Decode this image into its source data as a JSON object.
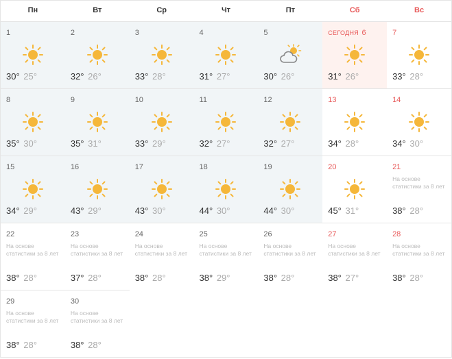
{
  "headers": [
    {
      "label": "Пн",
      "weekend": false
    },
    {
      "label": "Вт",
      "weekend": false
    },
    {
      "label": "Ср",
      "weekend": false
    },
    {
      "label": "Чт",
      "weekend": false
    },
    {
      "label": "Пт",
      "weekend": false
    },
    {
      "label": "Сб",
      "weekend": true
    },
    {
      "label": "Вс",
      "weekend": true
    }
  ],
  "today_label": "СЕГОДНЯ",
  "stat_note": "На основе статистики за 8 лет",
  "days": [
    {
      "num": "1",
      "icon": "sun",
      "high": "30°",
      "low": "25°",
      "weekend": false,
      "today": false,
      "stat": false,
      "shaded": true
    },
    {
      "num": "2",
      "icon": "sun",
      "high": "32°",
      "low": "26°",
      "weekend": false,
      "today": false,
      "stat": false,
      "shaded": true
    },
    {
      "num": "3",
      "icon": "sun",
      "high": "33°",
      "low": "28°",
      "weekend": false,
      "today": false,
      "stat": false,
      "shaded": true
    },
    {
      "num": "4",
      "icon": "sun",
      "high": "31°",
      "low": "27°",
      "weekend": false,
      "today": false,
      "stat": false,
      "shaded": true
    },
    {
      "num": "5",
      "icon": "cloud-sun",
      "high": "30°",
      "low": "26°",
      "weekend": false,
      "today": false,
      "stat": false,
      "shaded": true
    },
    {
      "num": "6",
      "icon": "sun",
      "high": "31°",
      "low": "26°",
      "weekend": true,
      "today": true,
      "stat": false,
      "shaded": false
    },
    {
      "num": "7",
      "icon": "sun",
      "high": "33°",
      "low": "28°",
      "weekend": true,
      "today": false,
      "stat": false,
      "shaded": false
    },
    {
      "num": "8",
      "icon": "sun",
      "high": "35°",
      "low": "30°",
      "weekend": false,
      "today": false,
      "stat": false,
      "shaded": true
    },
    {
      "num": "9",
      "icon": "sun",
      "high": "35°",
      "low": "31°",
      "weekend": false,
      "today": false,
      "stat": false,
      "shaded": true
    },
    {
      "num": "10",
      "icon": "sun",
      "high": "33°",
      "low": "29°",
      "weekend": false,
      "today": false,
      "stat": false,
      "shaded": true
    },
    {
      "num": "11",
      "icon": "sun",
      "high": "32°",
      "low": "27°",
      "weekend": false,
      "today": false,
      "stat": false,
      "shaded": true
    },
    {
      "num": "12",
      "icon": "sun",
      "high": "32°",
      "low": "27°",
      "weekend": false,
      "today": false,
      "stat": false,
      "shaded": true
    },
    {
      "num": "13",
      "icon": "sun",
      "high": "34°",
      "low": "28°",
      "weekend": true,
      "today": false,
      "stat": false,
      "shaded": false
    },
    {
      "num": "14",
      "icon": "sun",
      "high": "34°",
      "low": "30°",
      "weekend": true,
      "today": false,
      "stat": false,
      "shaded": false
    },
    {
      "num": "15",
      "icon": "sun",
      "high": "34°",
      "low": "29°",
      "weekend": false,
      "today": false,
      "stat": false,
      "shaded": true
    },
    {
      "num": "16",
      "icon": "sun",
      "high": "43°",
      "low": "29°",
      "weekend": false,
      "today": false,
      "stat": false,
      "shaded": true
    },
    {
      "num": "17",
      "icon": "sun",
      "high": "43°",
      "low": "30°",
      "weekend": false,
      "today": false,
      "stat": false,
      "shaded": true
    },
    {
      "num": "18",
      "icon": "sun",
      "high": "44°",
      "low": "30°",
      "weekend": false,
      "today": false,
      "stat": false,
      "shaded": true
    },
    {
      "num": "19",
      "icon": "sun",
      "high": "44°",
      "low": "30°",
      "weekend": false,
      "today": false,
      "stat": false,
      "shaded": true
    },
    {
      "num": "20",
      "icon": "sun",
      "high": "45°",
      "low": "31°",
      "weekend": true,
      "today": false,
      "stat": false,
      "shaded": false
    },
    {
      "num": "21",
      "icon": "",
      "high": "38°",
      "low": "28°",
      "weekend": true,
      "today": false,
      "stat": true,
      "shaded": false
    },
    {
      "num": "22",
      "icon": "",
      "high": "38°",
      "low": "28°",
      "weekend": false,
      "today": false,
      "stat": true,
      "shaded": false
    },
    {
      "num": "23",
      "icon": "",
      "high": "37°",
      "low": "28°",
      "weekend": false,
      "today": false,
      "stat": true,
      "shaded": false
    },
    {
      "num": "24",
      "icon": "",
      "high": "38°",
      "low": "28°",
      "weekend": false,
      "today": false,
      "stat": true,
      "shaded": false
    },
    {
      "num": "25",
      "icon": "",
      "high": "38°",
      "low": "29°",
      "weekend": false,
      "today": false,
      "stat": true,
      "shaded": false
    },
    {
      "num": "26",
      "icon": "",
      "high": "38°",
      "low": "28°",
      "weekend": false,
      "today": false,
      "stat": true,
      "shaded": false
    },
    {
      "num": "27",
      "icon": "",
      "high": "38°",
      "low": "27°",
      "weekend": true,
      "today": false,
      "stat": true,
      "shaded": false
    },
    {
      "num": "28",
      "icon": "",
      "high": "38°",
      "low": "28°",
      "weekend": true,
      "today": false,
      "stat": true,
      "shaded": false
    },
    {
      "num": "29",
      "icon": "",
      "high": "38°",
      "low": "28°",
      "weekend": false,
      "today": false,
      "stat": true,
      "shaded": false
    },
    {
      "num": "30",
      "icon": "",
      "high": "38°",
      "low": "28°",
      "weekend": false,
      "today": false,
      "stat": true,
      "shaded": false
    }
  ]
}
